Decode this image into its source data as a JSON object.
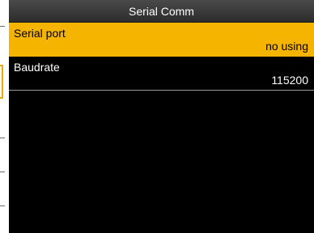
{
  "screen": {
    "title": "Serial Comm",
    "selected_color": "#f5b400",
    "background_color": "#000000"
  },
  "items": [
    {
      "label": "Serial port",
      "value": "no using",
      "selected": true
    },
    {
      "label": "Baudrate",
      "value": "115200",
      "selected": false
    }
  ]
}
